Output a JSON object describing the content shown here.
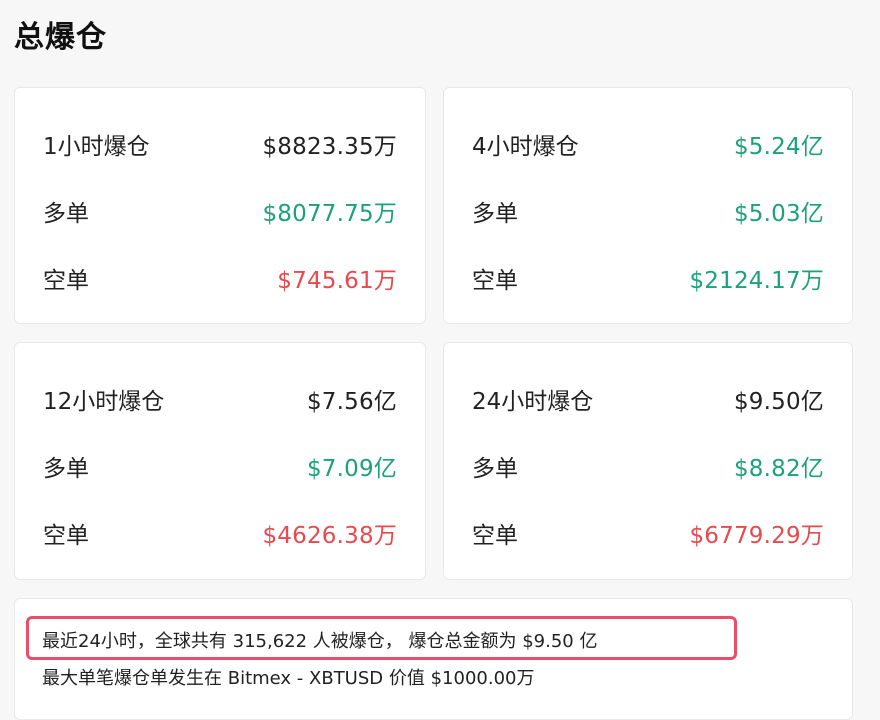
{
  "header": {
    "title": "总爆仓"
  },
  "colors": {
    "neutral": "#222222",
    "positive": "#1ba27a",
    "negative": "#e8494f",
    "highlight_border": "#ea4e6b"
  },
  "cards": [
    {
      "title": "1小时爆仓",
      "total": "$8823.35万",
      "total_color": "neutral",
      "long_label": "多单",
      "long": "$8077.75万",
      "short_label": "空单",
      "short": "$745.61万"
    },
    {
      "title": "4小时爆仓",
      "total": "$5.24亿",
      "total_color": "positive",
      "long_label": "多单",
      "long": "$5.03亿",
      "short_label": "空单",
      "short": "$2124.17万"
    },
    {
      "title": "12小时爆仓",
      "total": "$7.56亿",
      "total_color": "neutral",
      "long_label": "多单",
      "long": "$7.09亿",
      "short_label": "空单",
      "short": "$4626.38万"
    },
    {
      "title": "24小时爆仓",
      "total": "$9.50亿",
      "total_color": "neutral",
      "long_label": "多单",
      "long": "$8.82亿",
      "short_label": "空单",
      "short": "$6779.29万"
    }
  ],
  "summary": {
    "line1": "最近24小时，全球共有 315,622 人被爆仓， 爆仓总金额为 $9.50 亿",
    "line2": "最大单笔爆仓单发生在 Bitmex - XBTUSD 价值 $1000.00万"
  }
}
